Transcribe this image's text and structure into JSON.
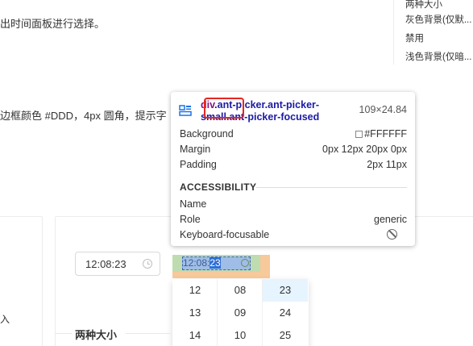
{
  "doc": {
    "line1": "出时间面板进行选择。",
    "line2": "边框颜色 #DDD，4px 圆角，提示字"
  },
  "toc": [
    "两种大小",
    "灰色背景(仅默...",
    "禁用",
    "浅色背景(仅暗..."
  ],
  "card": {
    "edge_text": "入",
    "picker_value": "12:08:23",
    "picker_sm_value_pre": "12:08:",
    "picker_sm_value_sel": "23",
    "section_title": "两种大小"
  },
  "dropdown": {
    "columns": [
      [
        "12",
        "13",
        "14"
      ],
      [
        "08",
        "09",
        "10"
      ],
      [
        "23",
        "24",
        "25"
      ]
    ]
  },
  "tooltip": {
    "tag": "div",
    "classes": ".ant-picker.ant-picker-small.ant-picker-focused",
    "width": "109",
    "times": "×",
    "height": "24.84",
    "rows": [
      {
        "key": "Background",
        "value": "#FFFFFF"
      },
      {
        "key": "Margin",
        "value": "0px 12px 20px 0px"
      },
      {
        "key": "Padding",
        "value": "2px 11px"
      }
    ],
    "accessibility_title": "ACCESSIBILITY",
    "acc_rows": [
      {
        "key": "Name",
        "value": ""
      },
      {
        "key": "Role",
        "value": "generic"
      },
      {
        "key": "Keyboard-focusable",
        "value": ""
      }
    ]
  },
  "colors": {
    "highlight_margin": "#f6c390",
    "highlight_padding": "#bfdcb0",
    "highlight_content": "#9fbde6",
    "annotation_red": "#e5271f"
  }
}
